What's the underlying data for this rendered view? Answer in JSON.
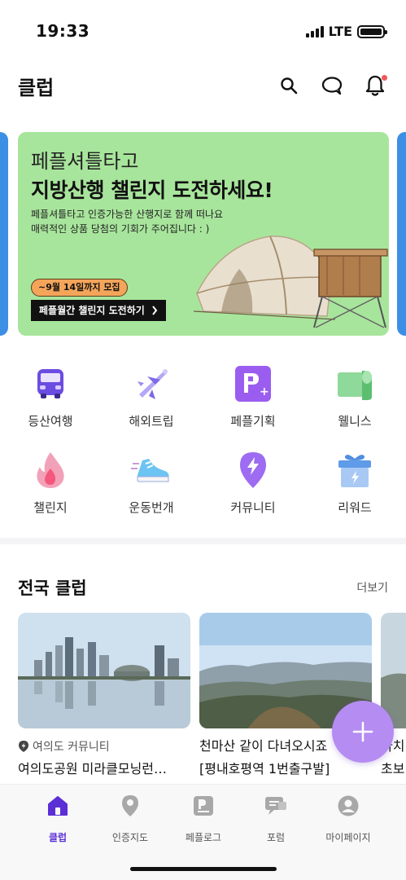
{
  "status_bar": {
    "time": "19:33",
    "network": "LTE"
  },
  "header": {
    "title": "클럽",
    "icons": [
      "search-icon",
      "chat-icon",
      "bell-icon"
    ],
    "notification_dot_color": "#f25757"
  },
  "banner": {
    "brand": "페플셔틀타고",
    "headline": "지방산행 챌린지 도전하세요!",
    "desc_line1": "페플셔틀타고 인증가능한 산행지로 함께 떠나요",
    "desc_line2": "매력적인 상품 당첨의 기회가 주어집니다 : )",
    "deadline": "~9월 14일까지 모집",
    "cta": "페플월간 챌린지 도전하기",
    "background_color": "#a8e59c"
  },
  "categories": [
    {
      "label": "등산여행",
      "icon": "bus-icon"
    },
    {
      "label": "해외트립",
      "icon": "airplane-icon"
    },
    {
      "label": "페플기획",
      "icon": "p-plus-icon"
    },
    {
      "label": "웰니스",
      "icon": "yoga-mat-icon"
    },
    {
      "label": "챌린지",
      "icon": "flame-icon"
    },
    {
      "label": "운동번개",
      "icon": "sneaker-icon"
    },
    {
      "label": "커뮤니티",
      "icon": "lightning-pin-icon"
    },
    {
      "label": "리워드",
      "icon": "gift-box-icon"
    }
  ],
  "clubs": {
    "title": "전국 클럽",
    "more": "더보기",
    "items": [
      {
        "location": "여의도 커뮤니티",
        "name": "여의도공원 미라클모닝런…"
      },
      {
        "name": "천마산 같이 다녀오시죠",
        "name2": "[평내호평역 1번출구발]"
      },
      {
        "name": "아치",
        "name2": "초보"
      }
    ]
  },
  "tabs": [
    {
      "label": "클럽",
      "icon": "home-icon",
      "active": true
    },
    {
      "label": "인증지도",
      "icon": "map-pin-icon",
      "active": false
    },
    {
      "label": "페플로그",
      "icon": "log-icon",
      "active": false
    },
    {
      "label": "포럼",
      "icon": "forum-icon",
      "active": false
    },
    {
      "label": "마이페이지",
      "icon": "profile-icon",
      "active": false
    }
  ],
  "colors": {
    "accent": "#5b2fd6",
    "fab": "#b58cf2"
  }
}
